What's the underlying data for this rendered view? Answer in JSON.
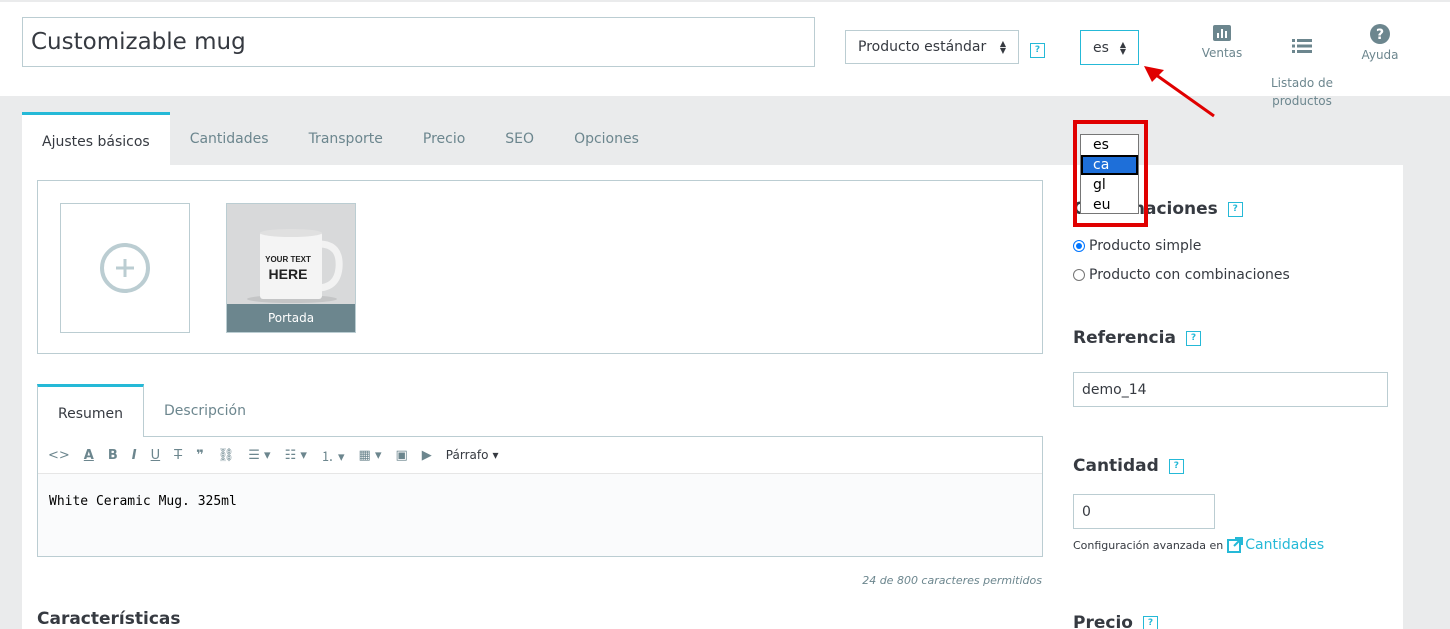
{
  "header": {
    "product_name": "Customizable mug",
    "product_type": "Producto estándar",
    "language": "es",
    "links": [
      {
        "label": "Ventas"
      },
      {
        "label": "Listado de\nproductos"
      },
      {
        "label": "Ayuda"
      }
    ]
  },
  "tabs": [
    "Ajustes básicos",
    "Cantidades",
    "Transporte",
    "Precio",
    "SEO",
    "Opciones"
  ],
  "images": {
    "cover_label": "Portada",
    "mug_text_1": "YOUR TEXT",
    "mug_text_2": "HERE"
  },
  "description": {
    "tabs": [
      "Resumen",
      "Descripción"
    ],
    "paragraph_label": "Párrafo",
    "content": "White Ceramic Mug. 325ml",
    "char_count": "24 de 800 caracteres permitidos"
  },
  "features_title": "Características",
  "right": {
    "combinations_title": "Combinaciones",
    "simple_product": "Producto simple",
    "combinations_product": "Producto con combinaciones",
    "reference_title": "Referencia",
    "reference_value": "demo_14",
    "quantity_title": "Cantidad",
    "quantity_value": "0",
    "advanced_config": "Configuración avanzada en",
    "advanced_link": "Cantidades",
    "price_title": "Precio"
  },
  "language_options": [
    "es",
    "ca",
    "gl",
    "eu"
  ],
  "help_mark": "?",
  "colors": {
    "accent": "#25b9d7",
    "highlight": "#e00000",
    "selected_option": "#1e6fd9"
  }
}
